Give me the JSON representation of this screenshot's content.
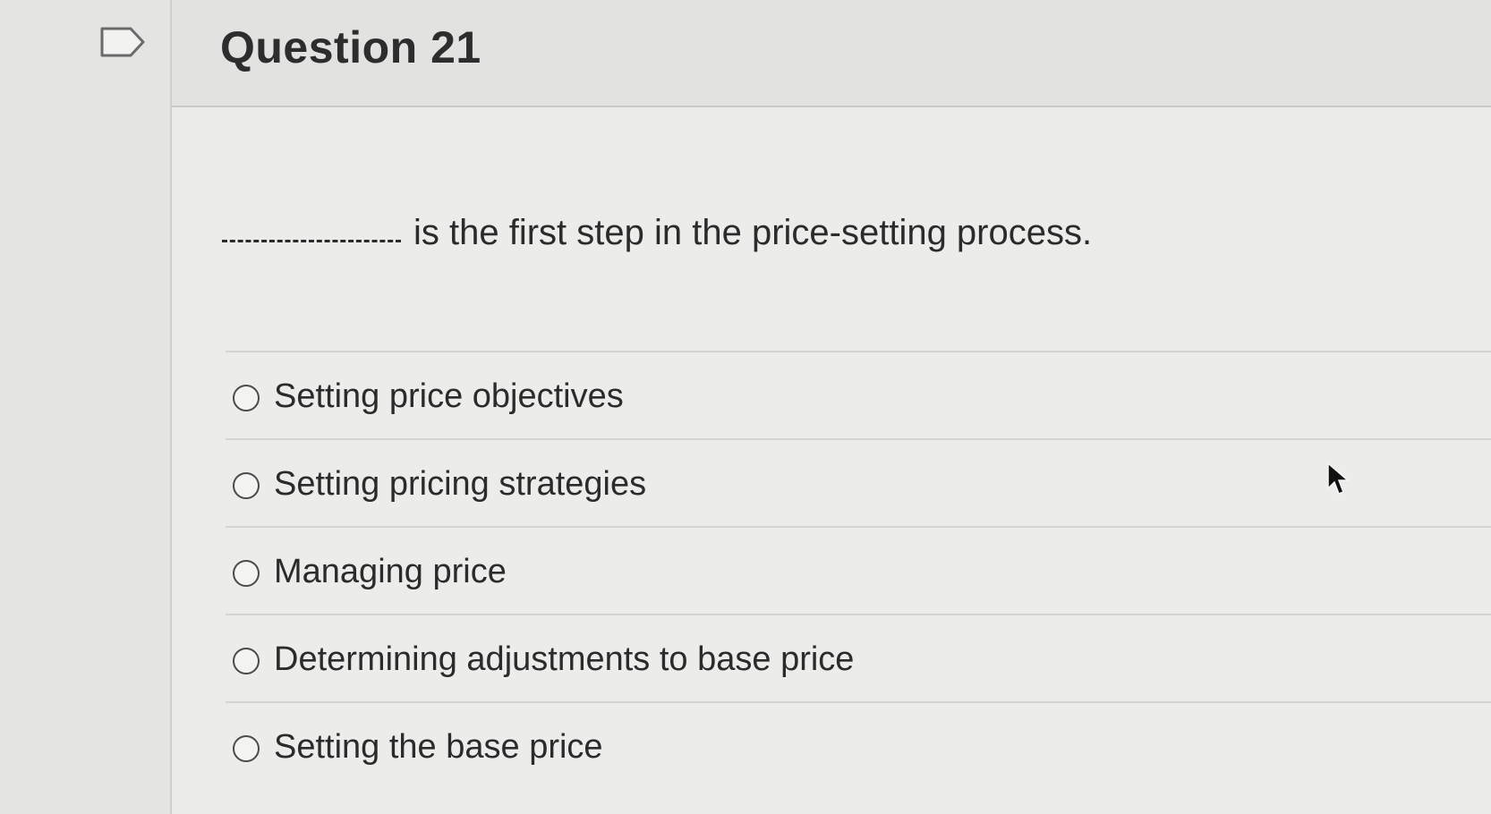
{
  "question": {
    "title": "Question 21",
    "prompt": "is the first step in the price-setting process."
  },
  "answers": [
    {
      "label": "Setting price objectives",
      "selected": false
    },
    {
      "label": "Setting pricing strategies",
      "selected": false
    },
    {
      "label": "Managing price",
      "selected": false
    },
    {
      "label": "Determining adjustments to base price",
      "selected": false
    },
    {
      "label": "Setting the base price",
      "selected": false
    }
  ],
  "icons": {
    "flag": "flag-question-icon",
    "cursor": "mouse-pointer-icon",
    "radio": "radio-unselected-icon"
  },
  "colors": {
    "text": "#2b2b2b",
    "background": "#ececeb",
    "divider": "#d4d4d3"
  }
}
